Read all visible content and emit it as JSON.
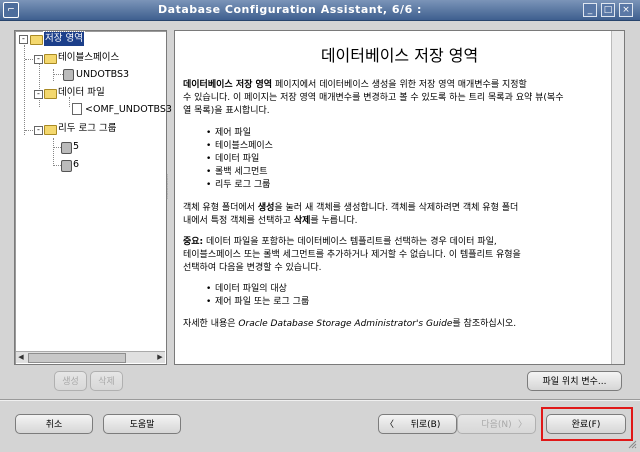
{
  "window": {
    "title": "Database Configuration Assistant,  6/6 :",
    "sys_icon": "⌐",
    "buttons": {
      "minimize": "_",
      "maximize": "□",
      "close": "×"
    }
  },
  "tree": {
    "root_label": "저장 영역",
    "tablespaces_label": "테이블스페이스",
    "undotbs_label": "UNDOTBS3",
    "datafiles_label": "데이터 파일",
    "omf_label": "<OMF_UNDOTBS3",
    "redo_label": "리두 로그 그룹",
    "redo_items": [
      "5",
      "6"
    ],
    "expander_open": "-"
  },
  "content": {
    "heading": "데이터베이스 저장 영역",
    "p1_bold": "데이터베이스 저장 영역",
    "p1_line1_rest": " 페이지에서 데이터베이스 생성을 위한 저장 영역 매개변수를 지정할",
    "p1_line2": "수 있습니다. 이 페이지는 저장 영역 매개변수를 변경하고 볼 수 있도록 하는 트리 목록과 요약 뷰(복수",
    "p1_line3": "열 목록)을 표시합니다.",
    "list1": [
      "제어 파일",
      "테이블스페이스",
      "데이터 파일",
      "롤백 세그먼트",
      "리두 로그 그룹"
    ],
    "p2_line1_pre": "객체 유형 폴더에서 ",
    "p2_bold1": "생성",
    "p2_line1_post": "을 눌러 새 객체를 생성합니다. 객체를 삭제하려면 객체 유형 폴더",
    "p2_line2_pre": "내에서 특정 객체를 선택하고 ",
    "p2_bold2": "삭제",
    "p2_line2_post": "를 누릅니다.",
    "p3_bold": "중요:",
    "p3_line1_rest": " 데이터 파일을 포함하는 데이터베이스 템플리트를 선택하는 경우 데이터 파일,",
    "p3_line2": "테이블스페이스 또는 롤백 세그먼트를 추가하거나 제거할 수 없습니다. 이 템플리트 유형을",
    "p3_line3": "선택하여 다음을 변경할 수 있습니다.",
    "list2": [
      "데이터 파일의 대상",
      "제어 파일 또는 로그 그룹"
    ],
    "p4_pre": "자세한 내용은 ",
    "p4_italic": "Oracle Database Storage Administrator's Guide",
    "p4_post": "를 참조하십시오."
  },
  "buttons": {
    "create": "생성",
    "delete": "삭제",
    "file_location": "파일 위치 변수...",
    "cancel": "취소",
    "help": "도움말",
    "back": "뒤로(B)",
    "back_arrow": "〈",
    "next": "다음(N)",
    "next_arrow": "〉",
    "finish": "완료(F)"
  }
}
